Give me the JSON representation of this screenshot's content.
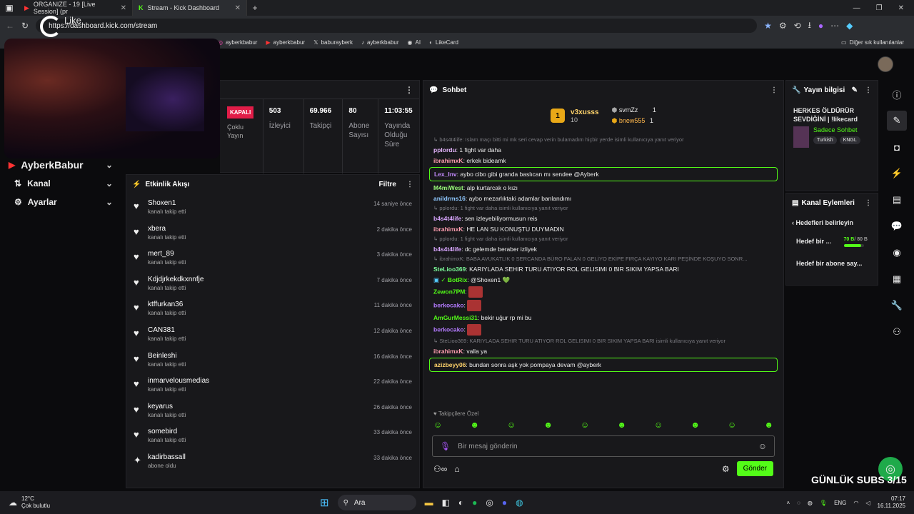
{
  "browser": {
    "tabs": [
      {
        "title": "ORGANIZE - 19 [Live Session] (pr",
        "icon": "youtube-icon"
      },
      {
        "title": "Stream - Kick Dashboard",
        "icon": "kick-icon"
      }
    ],
    "url": "https://dashboard.kick.com/stream",
    "overlay_label": "Like",
    "bookmarks": [
      "ayberkbabur",
      "ayberkbabur",
      "baburayberk",
      "ayberkbabur",
      "AI",
      "LikeCard"
    ],
    "other_bookmarks": "Diğer sık kullanılanlar"
  },
  "sidebar": {
    "channel_name": "AyberkBabur",
    "items": [
      {
        "label": "Kanal"
      },
      {
        "label": "Ayarlar"
      }
    ]
  },
  "stats": {
    "status": "KAPALI",
    "multi": "Çoklu Yayın",
    "items": [
      {
        "value": "503",
        "label": "İzleyici"
      },
      {
        "value": "69.966",
        "label": "Takipçi"
      },
      {
        "value": "80",
        "label": "Abone Sayısı"
      },
      {
        "value": "11:03:55",
        "label": "Yayında Olduğu Süre"
      }
    ]
  },
  "activity": {
    "title": "Etkinlik Akışı",
    "filter": "Filtre",
    "items": [
      {
        "name": "Shoxen1",
        "action": "kanalı takip etti",
        "time": "14 saniye önce"
      },
      {
        "name": "xbera",
        "action": "kanalı takip etti",
        "time": "2 dakika önce"
      },
      {
        "name": "mert_89",
        "action": "kanalı takip etti",
        "time": "3 dakika önce"
      },
      {
        "name": "Kdjdjrkekdkxnnfje",
        "action": "kanalı takip etti",
        "time": "7 dakika önce"
      },
      {
        "name": "ktffurkan36",
        "action": "kanalı takip etti",
        "time": "11 dakika önce"
      },
      {
        "name": "CAN381",
        "action": "kanalı takip etti",
        "time": "12 dakika önce"
      },
      {
        "name": "Beinleshi",
        "action": "kanalı takip etti",
        "time": "16 dakika önce"
      },
      {
        "name": "inmarvelousmedias",
        "action": "kanalı takip etti",
        "time": "22 dakika önce"
      },
      {
        "name": "keyarus",
        "action": "kanalı takip etti",
        "time": "26 dakika önce"
      },
      {
        "name": "somebird",
        "action": "kanalı takip etti",
        "time": "33 dakika önce"
      },
      {
        "name": "kadirbassall",
        "action": "abone oldu",
        "time": "33 dakika önce"
      }
    ]
  },
  "chat": {
    "title": "Sohbet",
    "leaderboard": {
      "first": {
        "rank": "1",
        "name": "v3xusss",
        "count": "10"
      },
      "others": [
        {
          "name": "svmZz",
          "count": "1"
        },
        {
          "name": "bnew555",
          "count": "1"
        }
      ]
    },
    "messages": [
      {
        "reply": "b4s4t4life: Islam maçı bitti mi mk seri cevap verin bulamadım hiçbir yerde isimli kullanıcıya yanıt veriyor"
      },
      {
        "user": "pplordu",
        "color": "#e7b6ff",
        "text": "1 fight var daha"
      },
      {
        "user": "ibrahimxK",
        "color": "#ff9eb0",
        "text": "erkek bideamk"
      },
      {
        "user": "Lex_Inv",
        "color": "#c48bff",
        "text": "aybo cibo gibi granda baslıcan mı sendee @Ayberk",
        "highlight": true
      },
      {
        "user": "M4miWest",
        "color": "#9bff7a",
        "text": "alp kurtarcak o kızı"
      },
      {
        "user": "anildrms16",
        "color": "#8fc8ff",
        "text": "aybo mezarlıktaki adamlar banlandımı"
      },
      {
        "reply": "pplordu: 1 fight var daha isimli kullanıcıya yanıt veriyor"
      },
      {
        "user": "b4s4t4life",
        "color": "#d9a6ff",
        "text": "sen izleyebiliyormusun reis"
      },
      {
        "user": "ibrahimxK",
        "color": "#ff9eb0",
        "text": "HE LAN SU KONUŞTU DUYMADIN"
      },
      {
        "reply": "pplordu: 1 fight var daha isimli kullanıcıya yanıt veriyor"
      },
      {
        "user": "b4s4t4life",
        "color": "#d9a6ff",
        "text": "dc gelemde beraber izliyek"
      },
      {
        "reply": "ibrahimxK: BABA AVUKATLIK 0 SERCANDA BÜRO FALAN 0 GELİYO EKİPE FIRÇA KAYIYO KARI PEŞİNDE KOŞUYO SONR..."
      },
      {
        "user": "SteLioo369",
        "color": "#7dff9a",
        "text": "KARIYLADA SEHIR TURU ATIYOR ROL GELISIMI 0 BIR SIKIM YAPSA BARI"
      },
      {
        "user": "BotRix",
        "color": "#53fc18",
        "text": "@Shoxen1 💚",
        "bot": true
      },
      {
        "user": "Zewon7PM",
        "color": "#53fc18",
        "text": "",
        "emote": true
      },
      {
        "user": "berkocako",
        "color": "#b47bff",
        "text": "",
        "emote": true
      },
      {
        "user": "AmGurMessi31",
        "color": "#53fc18",
        "text": "bekir uğur rp mi bu"
      },
      {
        "user": "berkocako",
        "color": "#b47bff",
        "text": "",
        "emote": true
      },
      {
        "reply": "SteLioo369: KARIYLADA SEHIR TURU ATIYOR ROL GELISIMI 0 BIR SIKIM YAPSA BARI isimli kullanıcıya yanıt veriyor"
      },
      {
        "user": "ibrahimxK",
        "color": "#ff9eb0",
        "text": "valla ya"
      },
      {
        "user": "azizbeyy06",
        "color": "#ffd36b",
        "text": "bundan sonra aşk yok pompaya devam @ayberk",
        "highlight": true
      }
    ],
    "followers_only": "Takipçilere Özel",
    "input_placeholder": "Bir mesaj gönderin",
    "send": "Gönder"
  },
  "stream_info": {
    "title": "Yayın bilgisi",
    "stream_title": "HERKES ÖLDÜRÜR SEVDİĞİNİ | !likecard",
    "category": "Sadece Sohbet",
    "tags": [
      "Turkish",
      "KNGL"
    ]
  },
  "channel_actions": {
    "title": "Kanal Eylemleri",
    "goals_title": "Hedefleri belirleyin",
    "goal1": {
      "label": "Hedef bir ...",
      "current": "70 B",
      "total": "/ 80 B",
      "fraction": 0.875
    },
    "goal2": {
      "label": "Hedef bir abone say..."
    }
  },
  "overlay_text": "GÜNLÜK SUBS 3/15",
  "taskbar": {
    "temp": "12°C",
    "weather": "Çok bulutlu",
    "search": "Ara",
    "lang": "ENG",
    "time": "07:17",
    "date": "16.11.2025"
  }
}
